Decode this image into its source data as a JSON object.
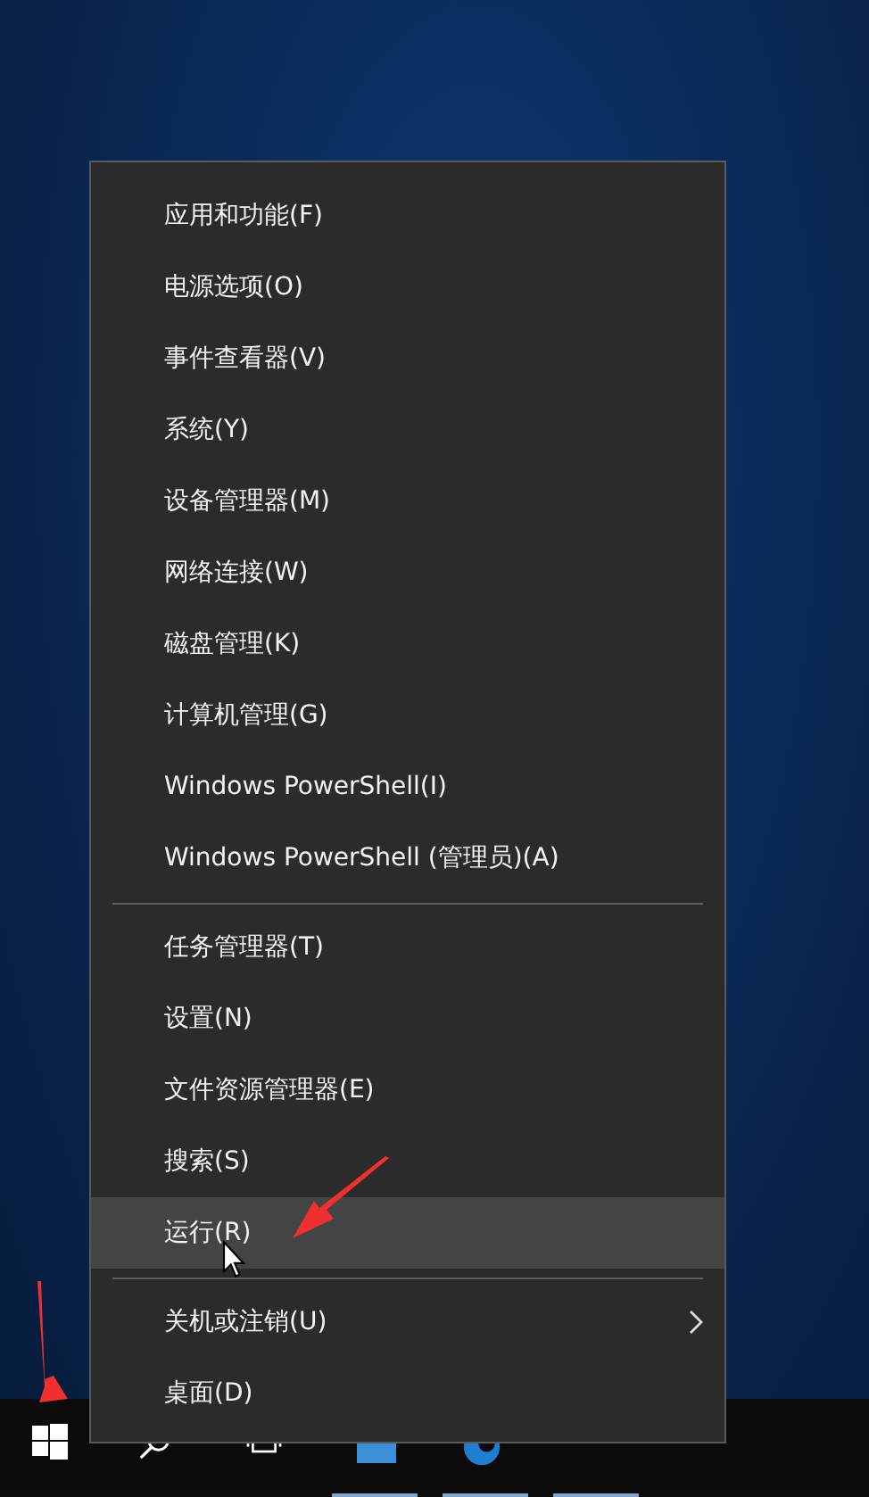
{
  "context_menu": {
    "groups": [
      [
        {
          "label": "应用和功能(F)",
          "selected": false,
          "submenu": false
        },
        {
          "label": "电源选项(O)",
          "selected": false,
          "submenu": false
        },
        {
          "label": "事件查看器(V)",
          "selected": false,
          "submenu": false
        },
        {
          "label": "系统(Y)",
          "selected": false,
          "submenu": false
        },
        {
          "label": "设备管理器(M)",
          "selected": false,
          "submenu": false
        },
        {
          "label": "网络连接(W)",
          "selected": false,
          "submenu": false
        },
        {
          "label": "磁盘管理(K)",
          "selected": false,
          "submenu": false
        },
        {
          "label": "计算机管理(G)",
          "selected": false,
          "submenu": false
        },
        {
          "label": "Windows PowerShell(I)",
          "selected": false,
          "submenu": false
        },
        {
          "label": "Windows PowerShell (管理员)(A)",
          "selected": false,
          "submenu": false
        }
      ],
      [
        {
          "label": "任务管理器(T)",
          "selected": false,
          "submenu": false
        },
        {
          "label": "设置(N)",
          "selected": false,
          "submenu": false
        },
        {
          "label": "文件资源管理器(E)",
          "selected": false,
          "submenu": false
        },
        {
          "label": "搜索(S)",
          "selected": false,
          "submenu": false
        },
        {
          "label": "运行(R)",
          "selected": true,
          "submenu": false
        }
      ],
      [
        {
          "label": "关机或注销(U)",
          "selected": false,
          "submenu": true
        },
        {
          "label": "桌面(D)",
          "selected": false,
          "submenu": false
        }
      ]
    ]
  }
}
